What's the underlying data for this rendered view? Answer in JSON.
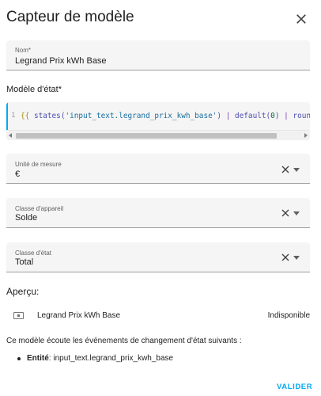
{
  "dialog": {
    "title": "Capteur de modèle",
    "close_icon": "close-icon"
  },
  "name_field": {
    "label": "Nom*",
    "value": "Legrand Prix kWh Base"
  },
  "state_template": {
    "label": "Modèle d'état*",
    "line_number": "1",
    "code_open": "{{",
    "code_fn": "states(",
    "code_str": "'input_text.legrand_prix_kwh_base'",
    "code_close": ")",
    "code_pipe1": "|",
    "code_default": "default(",
    "code_zero": "0",
    "code_default_close": ")",
    "code_pipe2": "|",
    "code_rest": "roun"
  },
  "unit_field": {
    "label": "Unité de mesure",
    "value": "€"
  },
  "device_class_field": {
    "label": "Classe d'appareil",
    "value": "Solde"
  },
  "state_class_field": {
    "label": "Classe d'état",
    "value": "Total"
  },
  "preview": {
    "title": "Aperçu:",
    "entity_icon": "cash-icon",
    "entity_name": "Legrand Prix kWh Base",
    "entity_state": "Indisponible"
  },
  "listeners": {
    "text": "Ce modèle écoute les événements de changement d'état suivants :",
    "items": [
      {
        "kind": "Entité",
        "value": "input_text.legrand_prix_kwh_base"
      }
    ]
  },
  "actions": {
    "submit_label": "VALIDER"
  },
  "colors": {
    "accent": "#03a9f4",
    "field_bg": "#f5f5f5"
  }
}
